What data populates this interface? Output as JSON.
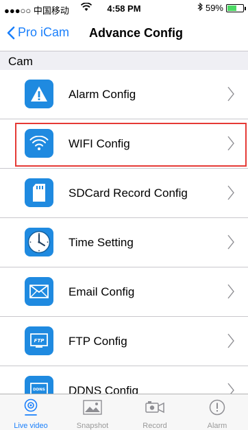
{
  "status_bar": {
    "carrier": "●●●○○ 中国移动",
    "time": "4:58 PM",
    "battery": "59%",
    "battery_level": 0.59
  },
  "nav": {
    "back_label": "Pro iCam",
    "title": "Advance Config"
  },
  "section": {
    "title": "Cam"
  },
  "menu": {
    "items": [
      {
        "label": "Alarm Config",
        "icon": "alert-triangle-icon"
      },
      {
        "label": "WIFI Config",
        "icon": "wifi-icon",
        "highlighted": true
      },
      {
        "label": "SDCard Record Config",
        "icon": "sd-card-icon"
      },
      {
        "label": "Time Setting",
        "icon": "clock-icon"
      },
      {
        "label": "Email Config",
        "icon": "envelope-icon"
      },
      {
        "label": "FTP Config",
        "icon": "ftp-icon",
        "icon_text": "FTP"
      },
      {
        "label": "DDNS Config",
        "icon": "ddns-icon",
        "icon_text": "DDNS"
      }
    ]
  },
  "tabs": [
    {
      "label": "Live video",
      "active": true
    },
    {
      "label": "Snapshot"
    },
    {
      "label": "Record"
    },
    {
      "label": "Alarm"
    }
  ],
  "colors": {
    "accent": "#1a7ffb",
    "icon_bg": "#1f8ae0",
    "highlight_border": "#e53935"
  }
}
